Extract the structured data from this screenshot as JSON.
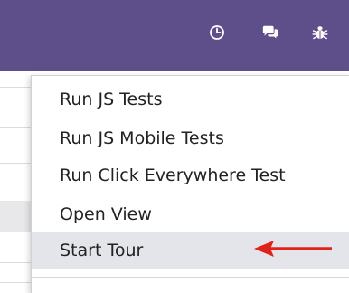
{
  "navbar": {
    "color": "#5e4f8b",
    "icons": [
      "clock-icon",
      "chat-icon",
      "bug-icon"
    ]
  },
  "debug_menu": {
    "items": [
      {
        "label": "Run JS Tests"
      },
      {
        "label": "Run JS Mobile Tests"
      },
      {
        "label": "Run Click Everywhere Test"
      },
      {
        "label": "Open View"
      },
      {
        "label": "Start Tour",
        "highlighted": true
      }
    ],
    "highlight_color": "#e3e5ea"
  },
  "annotation": {
    "type": "arrow",
    "color": "#e0231a",
    "points_to": "Start Tour"
  }
}
